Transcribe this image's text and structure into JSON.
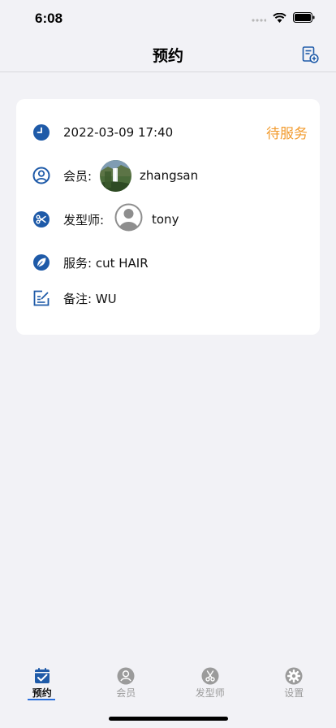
{
  "status_bar": {
    "time": "6:08"
  },
  "header": {
    "title": "预约"
  },
  "appointment": {
    "datetime": "2022-03-09 17:40",
    "status": "待服务",
    "member_label": "会员:",
    "member_name": "zhangsan",
    "stylist_label": "发型师:",
    "stylist_name": "tony",
    "service_label": "服务:",
    "service_value": "cut HAIR",
    "note_label": "备注:",
    "note_value": "WU"
  },
  "tab_bar": {
    "tabs": [
      {
        "label": "预约",
        "active": true
      },
      {
        "label": "会员",
        "active": false
      },
      {
        "label": "发型师",
        "active": false
      },
      {
        "label": "设置",
        "active": false
      }
    ]
  },
  "colors": {
    "accent": "#1e5aa8",
    "status": "#f29b2e",
    "inactive": "#9b9b9b",
    "background": "#f2f2f6"
  }
}
